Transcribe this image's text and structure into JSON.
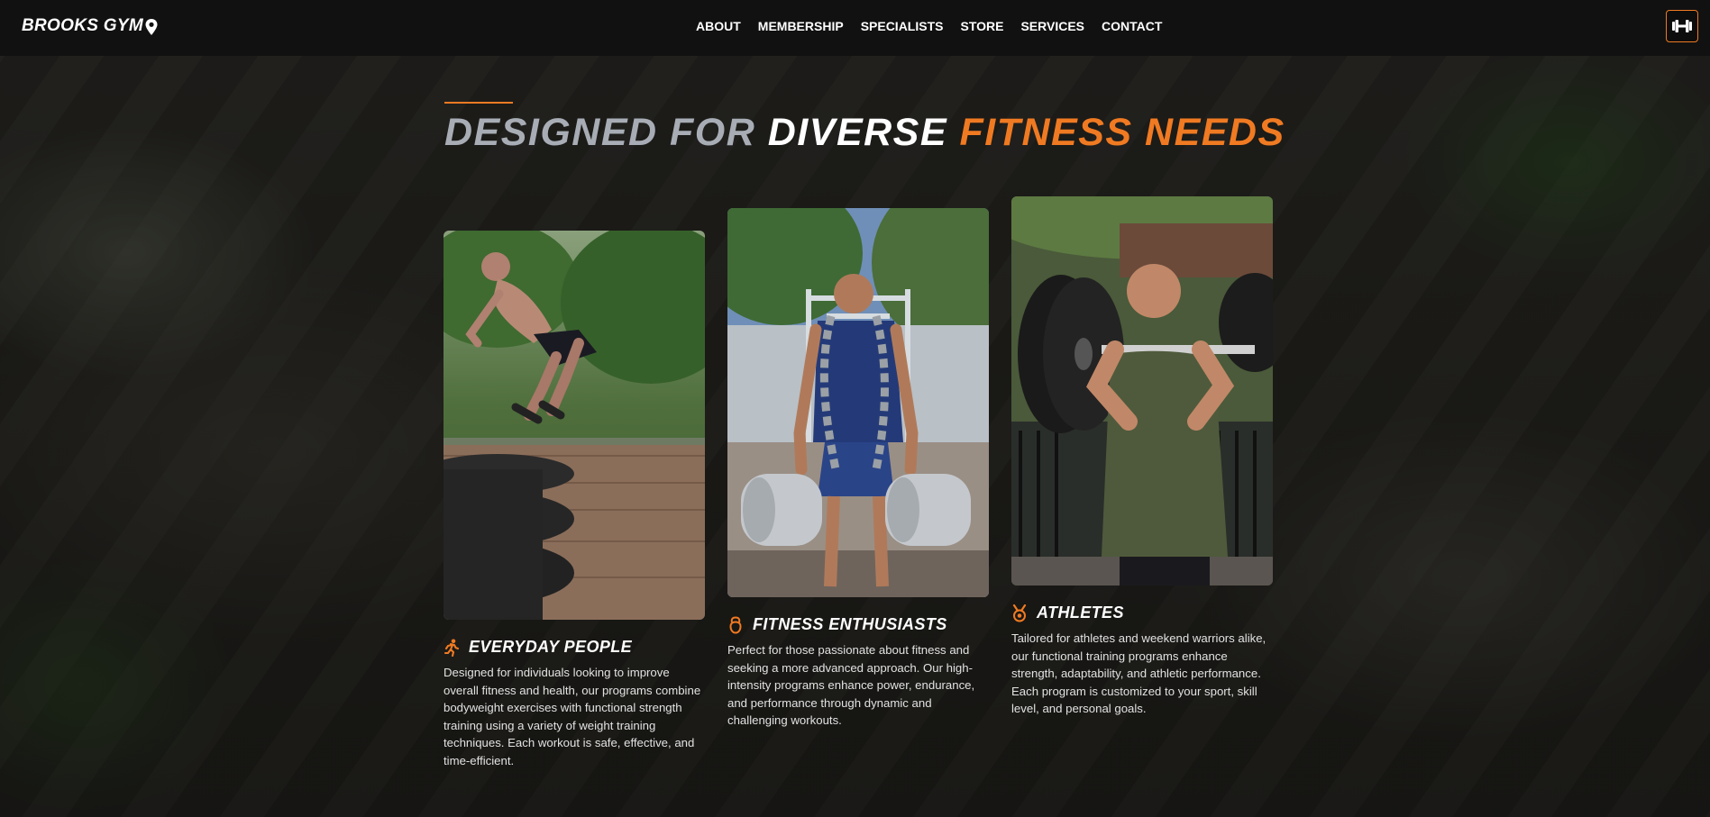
{
  "header": {
    "brand": "BROOKS GYM",
    "nav": [
      "ABOUT",
      "MEMBERSHIP",
      "SPECIALISTS",
      "STORE",
      "SERVICES",
      "CONTACT"
    ]
  },
  "section": {
    "heading_part1": "DESIGNED FOR",
    "heading_part2": "DIVERSE",
    "heading_part3": "FITNESS NEEDS"
  },
  "cards": [
    {
      "title": "EVERYDAY PEOPLE",
      "icon": "running-person-icon",
      "text": "Designed for individuals looking to improve overall fitness and health, our programs combine bodyweight exercises with functional strength training using a variety of weight training techniques. Each workout is safe, effective, and time-efficient."
    },
    {
      "title": "FITNESS ENTHUSIASTS",
      "icon": "kettlebell-icon",
      "text": "Perfect for those passionate about fitness and seeking a more advanced approach. Our high-intensity programs enhance power, endurance, and performance through dynamic and challenging workouts."
    },
    {
      "title": "ATHLETES",
      "icon": "medal-icon",
      "text": "Tailored for athletes and weekend warriors alike, our functional training programs enhance strength, adaptability, and athletic performance. Each program is customized to your sport, skill level, and personal goals."
    }
  ],
  "colors": {
    "accent": "#f07a22",
    "header_bg": "#111111",
    "heading_grey": "#a8adb5"
  }
}
